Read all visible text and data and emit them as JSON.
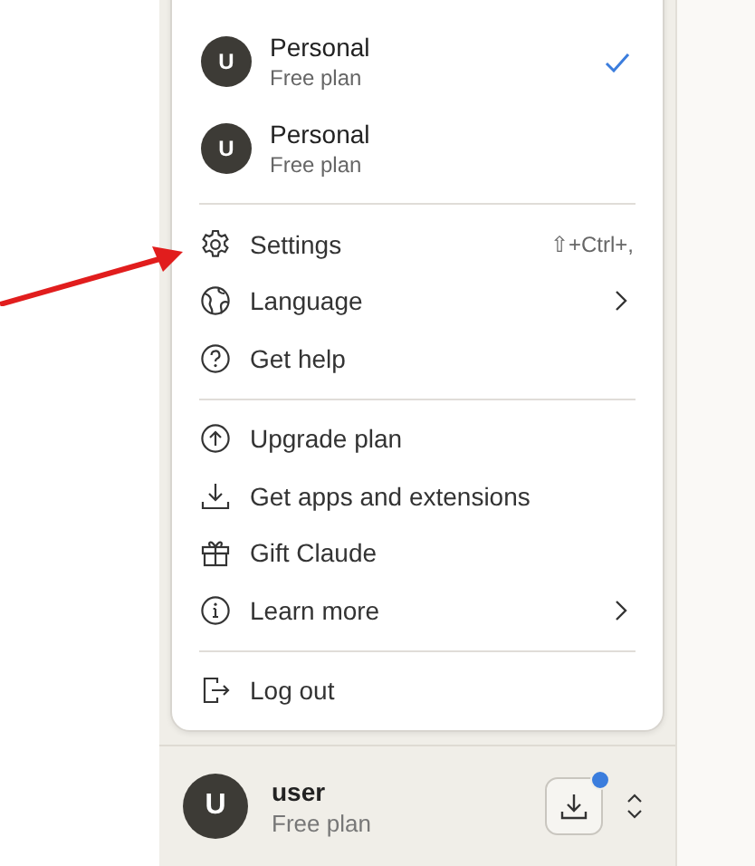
{
  "accounts": [
    {
      "avatar": "U",
      "name": "Personal",
      "plan": "Free plan",
      "selected": true
    },
    {
      "avatar": "U",
      "name": "Personal",
      "plan": "Free plan",
      "selected": false
    }
  ],
  "menu_sections": [
    [
      {
        "label": "Settings",
        "shortcut": "⇧+Ctrl+,",
        "submenu": false
      },
      {
        "label": "Language",
        "submenu": true
      },
      {
        "label": "Get help",
        "submenu": false
      }
    ],
    [
      {
        "label": "Upgrade plan",
        "submenu": false
      },
      {
        "label": "Get apps and extensions",
        "submenu": false
      },
      {
        "label": "Gift Claude",
        "submenu": false
      },
      {
        "label": "Learn more",
        "submenu": true
      }
    ],
    [
      {
        "label": "Log out",
        "submenu": false
      }
    ]
  ],
  "user": {
    "avatar": "U",
    "name": "user",
    "plan": "Free plan",
    "download_notification": true
  }
}
